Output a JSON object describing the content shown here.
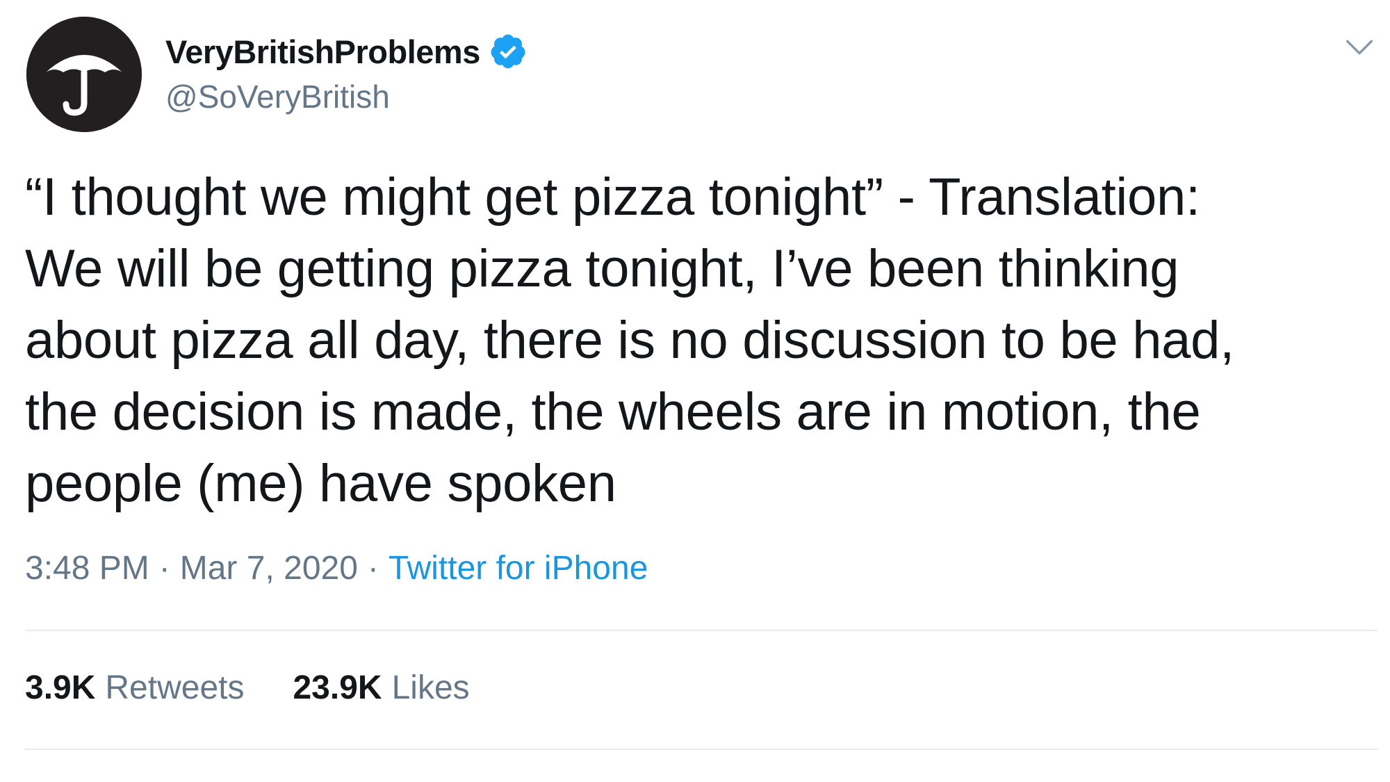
{
  "author": {
    "display_name": "VeryBritishProblems",
    "handle": "@SoVeryBritish",
    "verified": true,
    "avatar_icon": "umbrella-icon",
    "avatar_bg": "#231f20"
  },
  "tweet": {
    "text": "“I thought we might get pizza tonight” - Translation:\nWe will be getting pizza tonight, I’ve been thinking\nabout pizza all day, there is no discussion to be had,\nthe decision is made, the wheels are in motion, the\npeople (me) have spoken",
    "time": "3:48 PM",
    "separator": "·",
    "date": "Mar 7, 2020",
    "source": "Twitter for iPhone"
  },
  "stats": {
    "retweets_count": "3.9K",
    "retweets_label": "Retweets",
    "likes_count": "23.9K",
    "likes_label": "Likes"
  },
  "colors": {
    "text": "#14171a",
    "secondary": "#657786",
    "link": "#1b95e0",
    "verified_badge": "#1da1f2",
    "divider": "#e6ecf0"
  },
  "icons": {
    "verified": "verified-badge-icon",
    "more": "chevron-down-icon"
  }
}
